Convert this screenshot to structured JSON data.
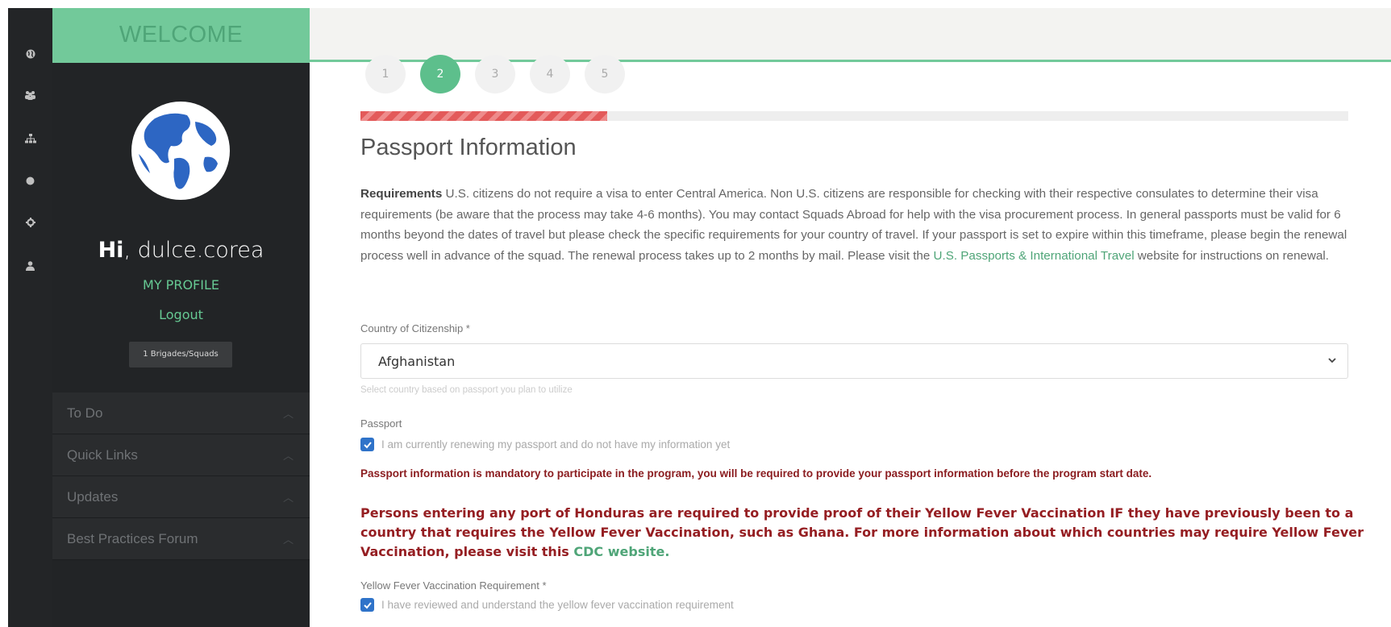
{
  "sidebar": {
    "welcome": "WELCOME",
    "greeting_bold": "Hi",
    "greeting_user": ", dulce.corea",
    "my_profile": "MY PROFILE",
    "logout": "Logout",
    "brigades_badge": "1 Brigades/Squads",
    "menu": [
      {
        "label": "To Do"
      },
      {
        "label": "Quick Links"
      },
      {
        "label": "Updates"
      },
      {
        "label": "Best Practices Forum"
      }
    ]
  },
  "rail_icons": [
    "globe-icon",
    "users-icon",
    "sitemap-icon",
    "circle-icon",
    "gear-icon",
    "user-icon"
  ],
  "steps": [
    {
      "label": "1",
      "active": false
    },
    {
      "label": "2",
      "active": true
    },
    {
      "label": "3",
      "active": false
    },
    {
      "label": "4",
      "active": false
    },
    {
      "label": "5",
      "active": false
    }
  ],
  "progress": {
    "current_step": 2,
    "total_steps": 5,
    "fraction": 0.25
  },
  "form": {
    "title": "Passport Information",
    "requirements_label": "Requirements",
    "requirements_text": " U.S. citizens do not require a visa to enter Central America. Non U.S. citizens are responsible for checking with their respective consulates to determine their visa requirements (be aware that the process may take 4-6 months). You may contact Squads Abroad for help with the visa procurement process. In general passports must be valid for 6 months beyond the dates of travel but please check the specific requirements for your country of travel. If your passport is set to expire within this timeframe, please begin the renewal process well in advance of the squad. The renewal process takes up to 2 months by mail. Please visit the ",
    "requirements_link": "U.S. Passports & International Travel",
    "requirements_tail": " website for instructions on renewal.",
    "country_label": "Country of Citizenship *",
    "country_value": "Afghanistan",
    "country_help": "Select country based on passport you plan to utilize",
    "passport_label": "Passport",
    "passport_checkbox": "I am currently renewing my passport and do not have my information yet",
    "passport_warning": "Passport information is mandatory to participate in the program, you will be required to provide your passport information before the program start date.",
    "yellow_fever_text": "Persons entering any port of Honduras are required to provide proof of their Yellow Fever Vaccination IF they have previously been to a country that requires the Yellow Fever Vaccination, such as Ghana. For more information about which countries may require Yellow Fever Vaccination, please visit this ",
    "yellow_fever_link": "CDC website.",
    "yf_label": "Yellow Fever Vaccination Requirement *",
    "yf_checkbox": "I have reviewed and understand the yellow fever vaccination requirement"
  },
  "colors": {
    "accent_green": "#72c99a",
    "link_green": "#4fa578",
    "sidebar_bg": "#222426",
    "warning_red": "#8b1d20",
    "progress_red": "#e35a5a",
    "checkbox_blue": "#2f73c9"
  }
}
